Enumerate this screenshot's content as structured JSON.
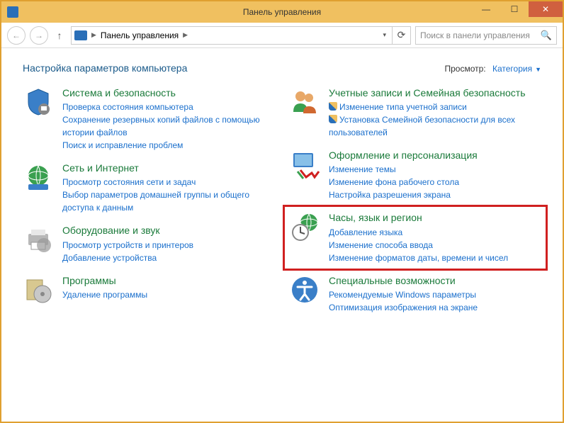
{
  "window": {
    "title": "Панель управления"
  },
  "nav": {
    "breadcrumb": "Панель управления",
    "search_placeholder": "Поиск в панели управления"
  },
  "header": {
    "title": "Настройка параметров компьютера",
    "view_label": "Просмотр:",
    "view_value": "Категория"
  },
  "categories": {
    "system": {
      "title": "Система и безопасность",
      "links": [
        "Проверка состояния компьютера",
        "Сохранение резервных копий файлов с помощью истории файлов",
        "Поиск и исправление проблем"
      ]
    },
    "network": {
      "title": "Сеть и Интернет",
      "links": [
        "Просмотр состояния сети и задач",
        "Выбор параметров домашней группы и общего доступа к данным"
      ]
    },
    "hardware": {
      "title": "Оборудование и звук",
      "links": [
        "Просмотр устройств и принтеров",
        "Добавление устройства"
      ]
    },
    "programs": {
      "title": "Программы",
      "links": [
        "Удаление программы"
      ]
    },
    "accounts": {
      "title": "Учетные записи и Семейная безопасность",
      "links": [
        "Изменение типа учетной записи",
        "Установка Семейной безопасности для всех пользователей"
      ]
    },
    "appearance": {
      "title": "Оформление и персонализация",
      "links": [
        "Изменение темы",
        "Изменение фона рабочего стола",
        "Настройка разрешения экрана"
      ]
    },
    "clock": {
      "title": "Часы, язык и регион",
      "links": [
        "Добавление языка",
        "Изменение способа ввода",
        "Изменение форматов даты, времени и чисел"
      ]
    },
    "access": {
      "title": "Специальные возможности",
      "links": [
        "Рекомендуемые Windows параметры",
        "Оптимизация изображения на экране"
      ]
    }
  }
}
